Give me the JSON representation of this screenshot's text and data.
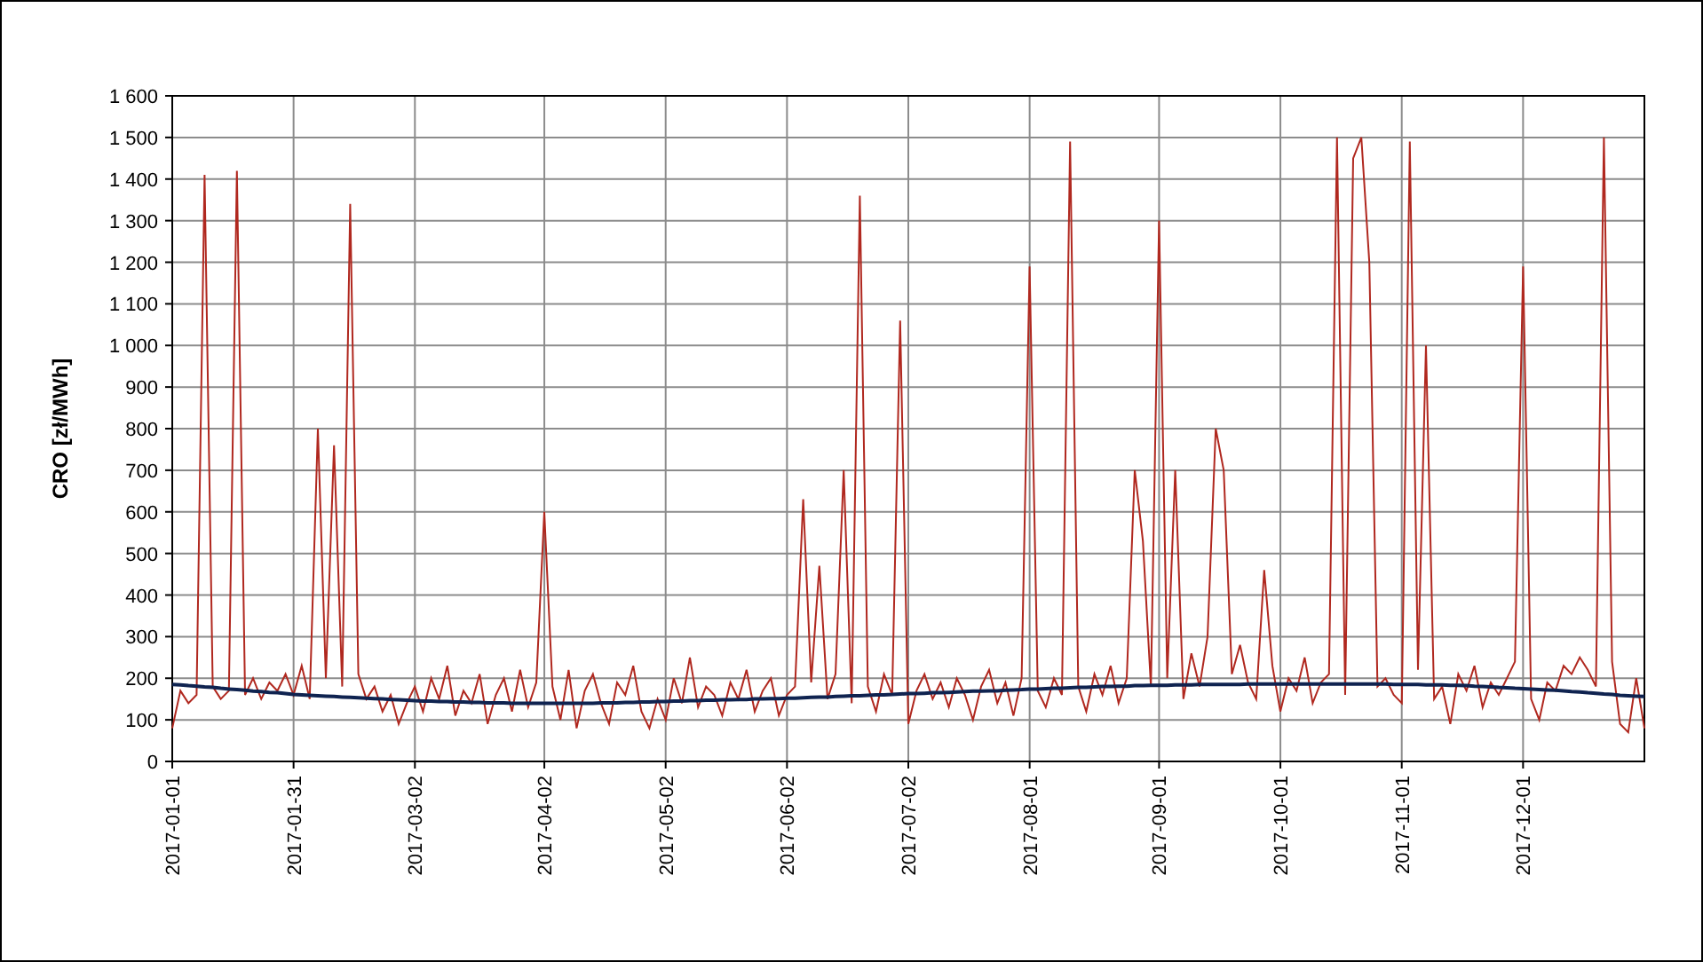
{
  "chart": {
    "chart_data": {
      "type": "line",
      "grid": true,
      "ylabel": "CRO [zł/MWh]",
      "ylim": [
        0,
        1600
      ],
      "yticks": [
        0,
        100,
        200,
        300,
        400,
        500,
        600,
        700,
        800,
        900,
        {
          "value": 1000,
          "label": "1 000"
        },
        {
          "value": 1100,
          "label": "1 100"
        },
        {
          "value": 1200,
          "label": "1 200"
        },
        {
          "value": 1300,
          "label": "1 300"
        },
        {
          "value": 1400,
          "label": "1 400"
        },
        {
          "value": 1500,
          "label": "1 500"
        },
        {
          "value": 1600,
          "label": "1 600"
        }
      ],
      "categories": [
        "2017-01-01",
        null,
        null,
        null,
        null,
        null,
        null,
        null,
        null,
        null,
        null,
        null,
        null,
        null,
        null,
        "2017-01-31",
        null,
        null,
        null,
        null,
        null,
        null,
        null,
        null,
        null,
        null,
        null,
        null,
        null,
        null,
        "2017-03-02",
        null,
        null,
        null,
        null,
        null,
        null,
        null,
        null,
        null,
        null,
        null,
        null,
        null,
        null,
        null,
        "2017-04-02",
        null,
        null,
        null,
        null,
        null,
        null,
        null,
        null,
        null,
        null,
        null,
        null,
        null,
        null,
        "2017-05-02",
        null,
        null,
        null,
        null,
        null,
        null,
        null,
        null,
        null,
        null,
        null,
        null,
        null,
        null,
        "2017-06-02",
        null,
        null,
        null,
        null,
        null,
        null,
        null,
        null,
        null,
        null,
        null,
        null,
        null,
        null,
        "2017-07-02",
        null,
        null,
        null,
        null,
        null,
        null,
        null,
        null,
        null,
        null,
        null,
        null,
        null,
        null,
        "2017-08-01",
        null,
        null,
        null,
        null,
        null,
        null,
        null,
        null,
        null,
        null,
        null,
        null,
        null,
        null,
        null,
        "2017-09-01",
        null,
        null,
        null,
        null,
        null,
        null,
        null,
        null,
        null,
        null,
        null,
        null,
        null,
        null,
        "2017-10-01",
        null,
        null,
        null,
        null,
        null,
        null,
        null,
        null,
        null,
        null,
        null,
        null,
        null,
        null,
        "2017-11-01",
        null,
        null,
        null,
        null,
        null,
        null,
        null,
        null,
        null,
        null,
        null,
        null,
        null,
        null,
        "2017-12-01",
        null,
        null,
        null,
        null,
        null,
        null,
        null,
        null,
        null,
        null,
        null,
        null,
        null,
        null,
        null
      ],
      "series": [
        {
          "color": "#b0281f",
          "values": [
            80,
            170,
            140,
            160,
            1410,
            180,
            150,
            170,
            1420,
            160,
            200,
            150,
            190,
            170,
            210,
            160,
            230,
            150,
            800,
            200,
            760,
            180,
            1340,
            210,
            150,
            180,
            120,
            160,
            90,
            140,
            180,
            120,
            200,
            150,
            230,
            110,
            170,
            140,
            210,
            90,
            160,
            200,
            120,
            220,
            130,
            190,
            600,
            180,
            100,
            220,
            80,
            170,
            210,
            140,
            90,
            190,
            160,
            230,
            120,
            80,
            150,
            100,
            200,
            140,
            250,
            130,
            180,
            160,
            110,
            190,
            150,
            220,
            120,
            170,
            200,
            110,
            160,
            180,
            630,
            190,
            470,
            150,
            210,
            700,
            140,
            1360,
            180,
            120,
            210,
            160,
            1060,
            90,
            170,
            210,
            150,
            190,
            130,
            200,
            160,
            100,
            180,
            220,
            140,
            190,
            110,
            200,
            1190,
            170,
            130,
            200,
            160,
            1490,
            180,
            120,
            210,
            160,
            230,
            140,
            200,
            700,
            530,
            180,
            1300,
            200,
            700,
            150,
            260,
            180,
            300,
            800,
            700,
            210,
            280,
            190,
            150,
            460,
            230,
            120,
            200,
            170,
            250,
            140,
            190,
            210,
            1500,
            160,
            1450,
            1500,
            1200,
            180,
            200,
            160,
            140,
            1490,
            220,
            1000,
            150,
            180,
            90,
            210,
            170,
            230,
            130,
            190,
            160,
            200,
            240,
            1190,
            150,
            100,
            190,
            170,
            230,
            210,
            250,
            220,
            180,
            1500,
            240,
            90,
            70,
            200,
            80
          ]
        },
        {
          "color": "#0f2350",
          "values": [
            185,
            184,
            182,
            181,
            179,
            178,
            176,
            174,
            173,
            171,
            169,
            168,
            166,
            165,
            163,
            161,
            160,
            159,
            158,
            157,
            156,
            155,
            154,
            153,
            152,
            151,
            150,
            149,
            148,
            147,
            146,
            145,
            145,
            144,
            144,
            143,
            143,
            142,
            142,
            141,
            141,
            141,
            140,
            140,
            140,
            140,
            140,
            140,
            140,
            140,
            140,
            140,
            140,
            141,
            141,
            141,
            142,
            142,
            143,
            143,
            144,
            144,
            145,
            145,
            146,
            146,
            147,
            147,
            148,
            148,
            149,
            149,
            150,
            150,
            151,
            151,
            152,
            152,
            153,
            154,
            155,
            155,
            156,
            157,
            158,
            158,
            159,
            160,
            160,
            161,
            162,
            163,
            163,
            164,
            165,
            165,
            166,
            167,
            168,
            169,
            169,
            170,
            170,
            171,
            172,
            173,
            174,
            174,
            175,
            176,
            176,
            177,
            178,
            178,
            179,
            180,
            180,
            181,
            181,
            182,
            182,
            183,
            183,
            183,
            184,
            184,
            184,
            185,
            185,
            185,
            185,
            185,
            185,
            186,
            186,
            186,
            186,
            186,
            186,
            186,
            186,
            186,
            186,
            186,
            186,
            186,
            186,
            186,
            186,
            186,
            186,
            185,
            185,
            185,
            185,
            184,
            184,
            184,
            183,
            183,
            182,
            181,
            180,
            179,
            178,
            177,
            176,
            175,
            174,
            173,
            172,
            171,
            170,
            168,
            167,
            165,
            164,
            162,
            161,
            159,
            158,
            157,
            156
          ]
        }
      ]
    }
  }
}
